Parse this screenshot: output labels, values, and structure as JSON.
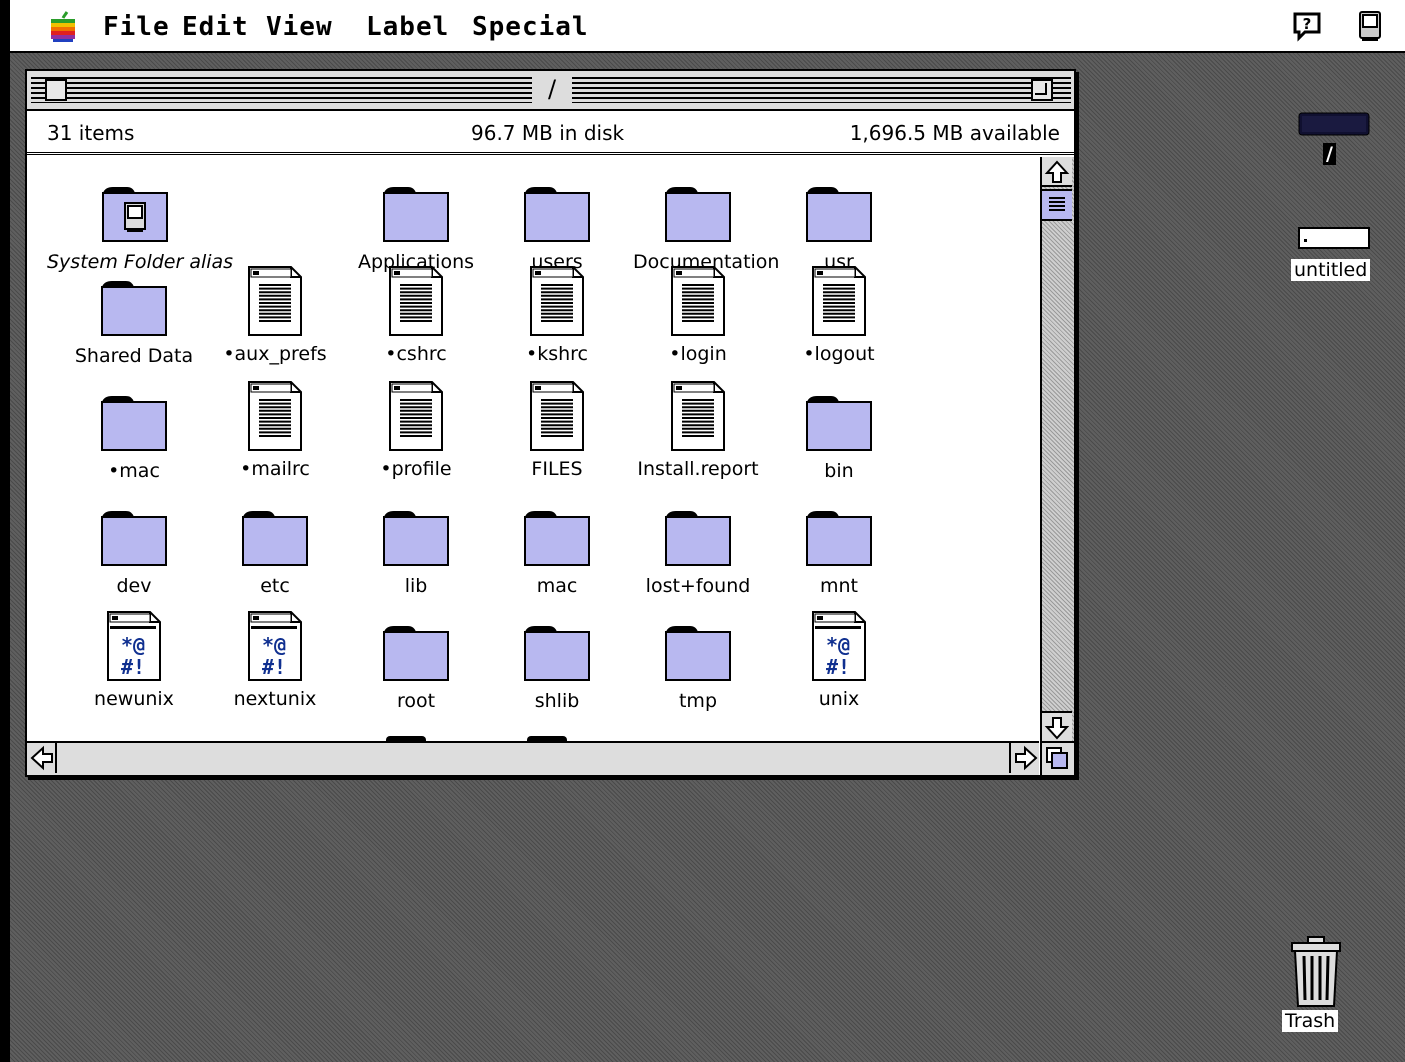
{
  "menubar": {
    "items": [
      "File",
      "Edit",
      "View",
      "Label",
      "Special"
    ]
  },
  "window": {
    "title": "/",
    "info": {
      "items": "31 items",
      "disk": "96.7 MB in disk",
      "available": "1,696.5 MB available"
    },
    "icons": [
      {
        "label": "System Folder alias",
        "type": "system-folder-icon"
      },
      {
        "label": "Applications",
        "type": "folder-icon"
      },
      {
        "label": "users",
        "type": "folder-icon"
      },
      {
        "label": "Documentation",
        "type": "folder-icon"
      },
      {
        "label": "usr",
        "type": "folder-icon"
      },
      {
        "label": "Shared Data",
        "type": "folder-icon"
      },
      {
        "label": "•aux_prefs",
        "type": "document-icon"
      },
      {
        "label": "•cshrc",
        "type": "document-icon"
      },
      {
        "label": "•kshrc",
        "type": "document-icon"
      },
      {
        "label": "•login",
        "type": "document-icon"
      },
      {
        "label": "•logout",
        "type": "document-icon"
      },
      {
        "label": "•mac",
        "type": "folder-icon"
      },
      {
        "label": "•mailrc",
        "type": "document-icon"
      },
      {
        "label": "•profile",
        "type": "document-icon"
      },
      {
        "label": "FILES",
        "type": "document-icon"
      },
      {
        "label": "Install.report",
        "type": "document-icon"
      },
      {
        "label": "bin",
        "type": "folder-icon"
      },
      {
        "label": "dev",
        "type": "folder-icon"
      },
      {
        "label": "etc",
        "type": "folder-icon"
      },
      {
        "label": "lib",
        "type": "folder-icon"
      },
      {
        "label": "mac",
        "type": "folder-icon"
      },
      {
        "label": "lost+found",
        "type": "folder-icon"
      },
      {
        "label": "mnt",
        "type": "folder-icon"
      },
      {
        "label": "newunix",
        "type": "unix-executable-icon"
      },
      {
        "label": "nextunix",
        "type": "unix-executable-icon"
      },
      {
        "label": "root",
        "type": "folder-icon"
      },
      {
        "label": "shlib",
        "type": "folder-icon"
      },
      {
        "label": "tmp",
        "type": "folder-icon"
      },
      {
        "label": "unix",
        "type": "unix-executable-icon"
      }
    ]
  },
  "desktop": {
    "root_disk_label": "/",
    "volume_label": "untitled",
    "trash_label": "Trash"
  },
  "colors": {
    "folder": "#b8b8f0",
    "desktop": "#555555"
  }
}
